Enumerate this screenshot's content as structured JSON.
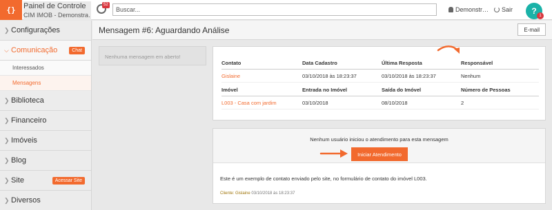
{
  "header": {
    "logo_glyph": "{}",
    "brand_title": "Painel de Controle",
    "brand_subtitle": "CIM IMOB - Demonstra…",
    "notifications_count": "52",
    "search_placeholder": "Buscar...",
    "user_label": "Demonstr…",
    "logout_label": "Sair",
    "help_label": "?",
    "help_badge": "1"
  },
  "sidebar": {
    "items": [
      {
        "label": "Configurações"
      },
      {
        "label": "Comunicação",
        "badge": "Chat"
      },
      {
        "label": "Interessados"
      },
      {
        "label": "Mensagens"
      },
      {
        "label": "Biblioteca"
      },
      {
        "label": "Financeiro"
      },
      {
        "label": "Imóveis"
      },
      {
        "label": "Blog"
      },
      {
        "label": "Site",
        "badge": "Acessar Site"
      },
      {
        "label": "Diversos"
      }
    ]
  },
  "page": {
    "title": "Mensagem #6: Aguardando Análise",
    "email_button": "E-mail",
    "empty_messages": "Nenhuma mensagem em aberto!"
  },
  "details": {
    "headers1": [
      "Contato",
      "Data Cadastro",
      "Última Resposta",
      "Responsável"
    ],
    "values1": [
      "Gislaine",
      "03/10/2018 às 18:23:37",
      "03/10/2018 às 18:23:37",
      "Nenhum"
    ],
    "headers2": [
      "Imóvel",
      "Entrada no Imóvel",
      "Saída do Imóvel",
      "Número de Pessoas"
    ],
    "values2": [
      "L003 - Casa com jardim",
      "03/10/2018",
      "08/10/2018",
      "2"
    ]
  },
  "attendance": {
    "notice": "Nenhum usuário iniciou o atendimento para esta mensagem",
    "start_button": "Iniciar Atendimento",
    "message": "Este é um exemplo de contato enviado pelo site, no formulário de contato do imóvel L003.",
    "meta_prefix": "Cliente: Gislaine",
    "meta_date": "03/10/2018 às 18:23:37"
  },
  "colors": {
    "accent": "#f26a2e",
    "help": "#1ab2a8",
    "badge": "#d9363e"
  }
}
